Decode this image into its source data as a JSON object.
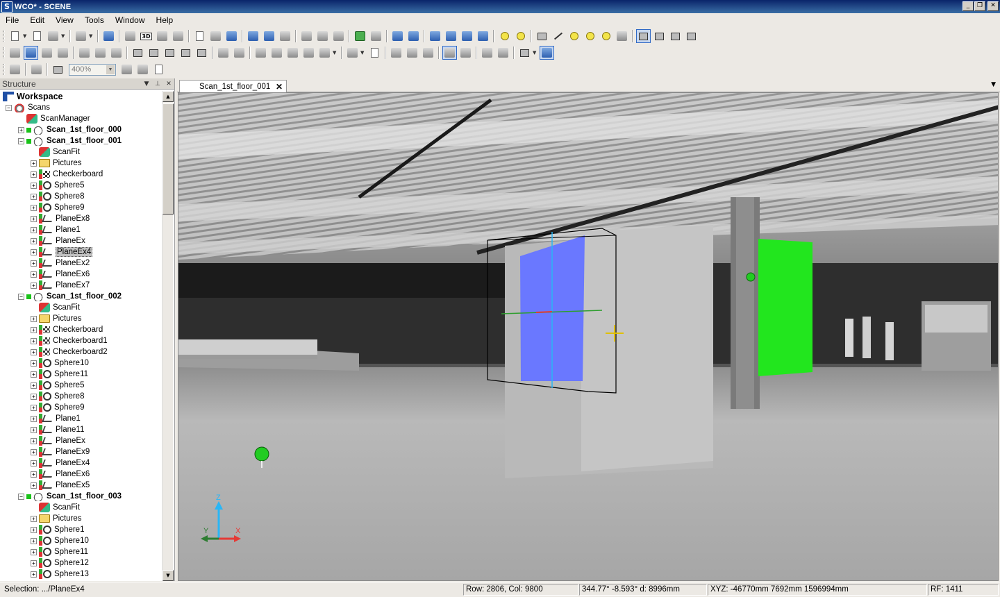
{
  "window": {
    "title": "WCO* - SCENE",
    "app_icon_letter": "S"
  },
  "menu": [
    "File",
    "Edit",
    "View",
    "Tools",
    "Window",
    "Help"
  ],
  "toolbar": {
    "zoom_value": "400%"
  },
  "structure": {
    "title": "Structure",
    "nodes": [
      {
        "label": "Workspace",
        "icon": "workspace-icon",
        "level": 0,
        "expander": "",
        "dot": false,
        "bold": true
      },
      {
        "label": "Scans",
        "icon": "scans-icon",
        "level": 1,
        "expander": "−",
        "dot": false,
        "bold": false
      },
      {
        "label": "ScanManager",
        "icon": "scanmanager-icon",
        "level": 2,
        "expander": "",
        "dot": false,
        "bold": false
      },
      {
        "label": "Scan_1st_floor_000",
        "icon": "scan-icon",
        "level": 2,
        "expander": "+",
        "dot": true,
        "bold": true
      },
      {
        "label": "Scan_1st_floor_001",
        "icon": "scan-icon",
        "level": 2,
        "expander": "−",
        "dot": true,
        "bold": true
      },
      {
        "label": "ScanFit",
        "icon": "scanfit-icon",
        "level": 3,
        "expander": "",
        "dot": false,
        "bold": false
      },
      {
        "label": "Pictures",
        "icon": "folder-icon",
        "level": 3,
        "expander": "+",
        "dot": false,
        "bold": false
      },
      {
        "label": "Checkerboard",
        "icon": "checkerboard-icon",
        "level": 3,
        "expander": "+",
        "dot": false,
        "bold": false
      },
      {
        "label": "Sphere5",
        "icon": "sphere-icon",
        "level": 3,
        "expander": "+",
        "dot": false,
        "bold": false
      },
      {
        "label": "Sphere8",
        "icon": "sphere-icon",
        "level": 3,
        "expander": "+",
        "dot": false,
        "bold": false
      },
      {
        "label": "Sphere9",
        "icon": "sphere-icon",
        "level": 3,
        "expander": "+",
        "dot": false,
        "bold": false
      },
      {
        "label": "PlaneEx8",
        "icon": "plane-icon",
        "level": 3,
        "expander": "+",
        "dot": false,
        "bold": false
      },
      {
        "label": "Plane1",
        "icon": "plane-icon",
        "level": 3,
        "expander": "+",
        "dot": false,
        "bold": false
      },
      {
        "label": "PlaneEx",
        "icon": "plane-icon",
        "level": 3,
        "expander": "+",
        "dot": false,
        "bold": false
      },
      {
        "label": "PlaneEx4",
        "icon": "plane-icon",
        "level": 3,
        "expander": "+",
        "dot": false,
        "bold": false,
        "selected": true
      },
      {
        "label": "PlaneEx2",
        "icon": "plane-icon",
        "level": 3,
        "expander": "+",
        "dot": false,
        "bold": false
      },
      {
        "label": "PlaneEx6",
        "icon": "plane-icon",
        "level": 3,
        "expander": "+",
        "dot": false,
        "bold": false
      },
      {
        "label": "PlaneEx7",
        "icon": "plane-icon",
        "level": 3,
        "expander": "+",
        "dot": false,
        "bold": false
      },
      {
        "label": "Scan_1st_floor_002",
        "icon": "scan-icon",
        "level": 2,
        "expander": "−",
        "dot": true,
        "bold": true
      },
      {
        "label": "ScanFit",
        "icon": "scanfit-icon",
        "level": 3,
        "expander": "",
        "dot": false,
        "bold": false
      },
      {
        "label": "Pictures",
        "icon": "folder-icon",
        "level": 3,
        "expander": "+",
        "dot": false,
        "bold": false
      },
      {
        "label": "Checkerboard",
        "icon": "checkerboard-icon",
        "level": 3,
        "expander": "+",
        "dot": false,
        "bold": false
      },
      {
        "label": "Checkerboard1",
        "icon": "checkerboard-icon",
        "level": 3,
        "expander": "+",
        "dot": false,
        "bold": false
      },
      {
        "label": "Checkerboard2",
        "icon": "checkerboard-icon",
        "level": 3,
        "expander": "+",
        "dot": false,
        "bold": false
      },
      {
        "label": "Sphere10",
        "icon": "sphere-icon",
        "level": 3,
        "expander": "+",
        "dot": false,
        "bold": false
      },
      {
        "label": "Sphere11",
        "icon": "sphere-icon",
        "level": 3,
        "expander": "+",
        "dot": false,
        "bold": false
      },
      {
        "label": "Sphere5",
        "icon": "sphere-icon",
        "level": 3,
        "expander": "+",
        "dot": false,
        "bold": false
      },
      {
        "label": "Sphere8",
        "icon": "sphere-icon",
        "level": 3,
        "expander": "+",
        "dot": false,
        "bold": false
      },
      {
        "label": "Sphere9",
        "icon": "sphere-icon",
        "level": 3,
        "expander": "+",
        "dot": false,
        "bold": false
      },
      {
        "label": "Plane1",
        "icon": "plane-icon",
        "level": 3,
        "expander": "+",
        "dot": false,
        "bold": false
      },
      {
        "label": "Plane11",
        "icon": "plane-icon",
        "level": 3,
        "expander": "+",
        "dot": false,
        "bold": false
      },
      {
        "label": "PlaneEx",
        "icon": "plane-icon",
        "level": 3,
        "expander": "+",
        "dot": false,
        "bold": false
      },
      {
        "label": "PlaneEx9",
        "icon": "plane-icon",
        "level": 3,
        "expander": "+",
        "dot": false,
        "bold": false
      },
      {
        "label": "PlaneEx4",
        "icon": "plane-icon",
        "level": 3,
        "expander": "+",
        "dot": false,
        "bold": false
      },
      {
        "label": "PlaneEx6",
        "icon": "plane-icon",
        "level": 3,
        "expander": "+",
        "dot": false,
        "bold": false
      },
      {
        "label": "PlaneEx5",
        "icon": "plane-icon",
        "level": 3,
        "expander": "+",
        "dot": false,
        "bold": false
      },
      {
        "label": "Scan_1st_floor_003",
        "icon": "scan-icon",
        "level": 2,
        "expander": "−",
        "dot": true,
        "bold": true
      },
      {
        "label": "ScanFit",
        "icon": "scanfit-icon",
        "level": 3,
        "expander": "",
        "dot": false,
        "bold": false
      },
      {
        "label": "Pictures",
        "icon": "folder-icon",
        "level": 3,
        "expander": "+",
        "dot": false,
        "bold": false
      },
      {
        "label": "Sphere1",
        "icon": "sphere-icon",
        "level": 3,
        "expander": "+",
        "dot": false,
        "bold": false
      },
      {
        "label": "Sphere10",
        "icon": "sphere-icon",
        "level": 3,
        "expander": "+",
        "dot": false,
        "bold": false
      },
      {
        "label": "Sphere11",
        "icon": "sphere-icon",
        "level": 3,
        "expander": "+",
        "dot": false,
        "bold": false
      },
      {
        "label": "Sphere12",
        "icon": "sphere-icon",
        "level": 3,
        "expander": "+",
        "dot": false,
        "bold": false
      },
      {
        "label": "Sphere13",
        "icon": "sphere-icon",
        "level": 3,
        "expander": "+",
        "dot": false,
        "bold": false
      }
    ]
  },
  "viewport": {
    "tab_label": "Scan_1st_floor_001",
    "axis_labels": {
      "z": "Z",
      "x": "X",
      "y": "Y"
    },
    "colors": {
      "plane_blue": "#6a78ff",
      "plane_green": "#22e61e",
      "sphere_green": "#22cc22",
      "axis_z": "#29b6f6",
      "axis_x": "#e53935",
      "axis_y": "#2e7d32"
    }
  },
  "status": {
    "selection": "Selection: .../PlaneEx4",
    "rowcol": "Row: 2806, Col: 9800",
    "angles": "344.77° -8.593°  d: 8996mm",
    "xyz": "XYZ: -46770mm 7692mm 1596994mm",
    "rf": "RF: 1411"
  }
}
